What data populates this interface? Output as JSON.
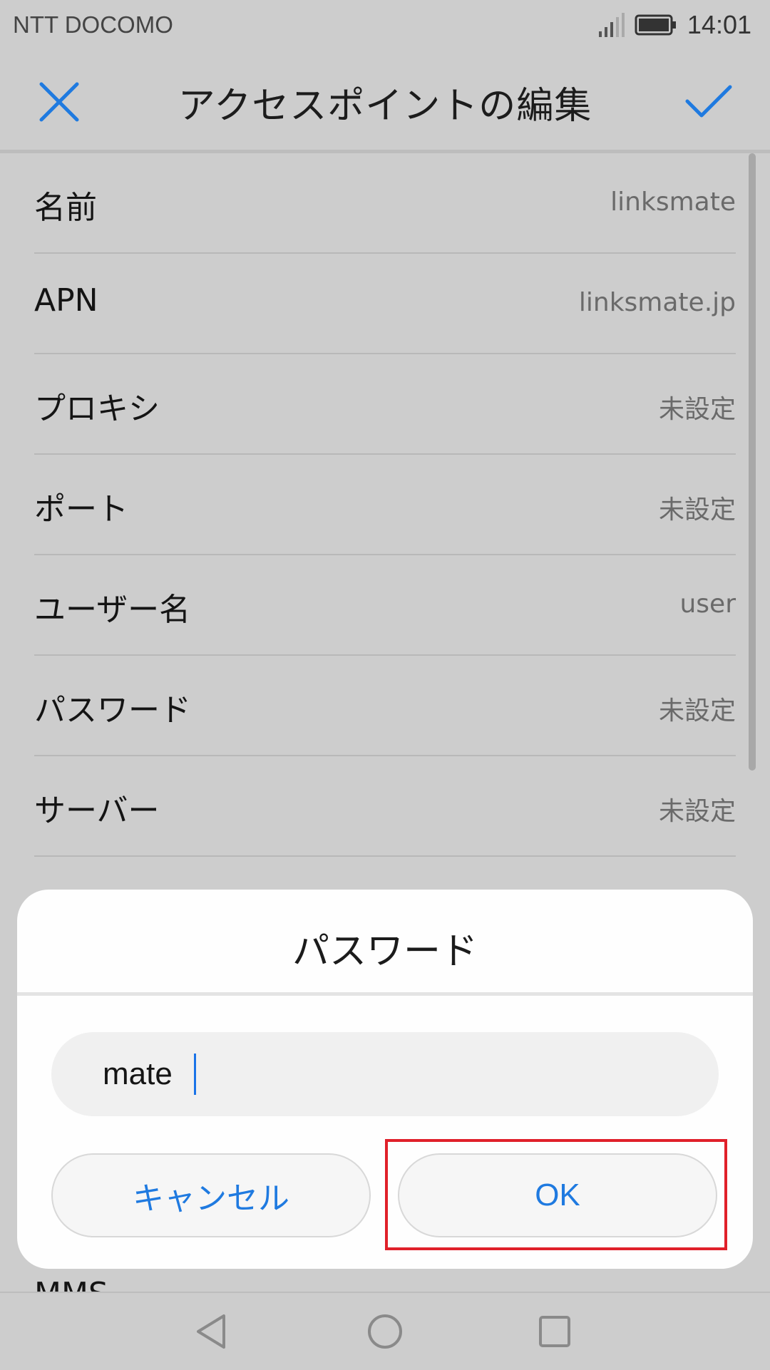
{
  "status_bar": {
    "carrier": "NTT DOCOMO",
    "time": "14:01",
    "icons": [
      "signal-icon",
      "battery-icon"
    ]
  },
  "app_bar": {
    "title": "アクセスポイントの編集",
    "close_icon": "close-icon",
    "confirm_icon": "check-icon",
    "accent_color": "#1f7ae0"
  },
  "settings": [
    {
      "label": "名前",
      "value": "linksmate"
    },
    {
      "label": "APN",
      "value": "linksmate.jp"
    },
    {
      "label": "プロキシ",
      "value": "未設定"
    },
    {
      "label": "ポート",
      "value": "未設定"
    },
    {
      "label": "ユーザー名",
      "value": "user"
    },
    {
      "label": "パスワード",
      "value": "未設定"
    },
    {
      "label": "サーバー",
      "value": "未設定"
    }
  ],
  "partial_row_label": "MMS",
  "dialog": {
    "title": "パスワード",
    "input_value": "mate",
    "cancel_label": "キャンセル",
    "ok_label": "OK",
    "highlight_color": "#e0202a"
  },
  "nav_bar": {
    "icons": [
      "back-icon",
      "home-icon",
      "recent-apps-icon"
    ]
  }
}
